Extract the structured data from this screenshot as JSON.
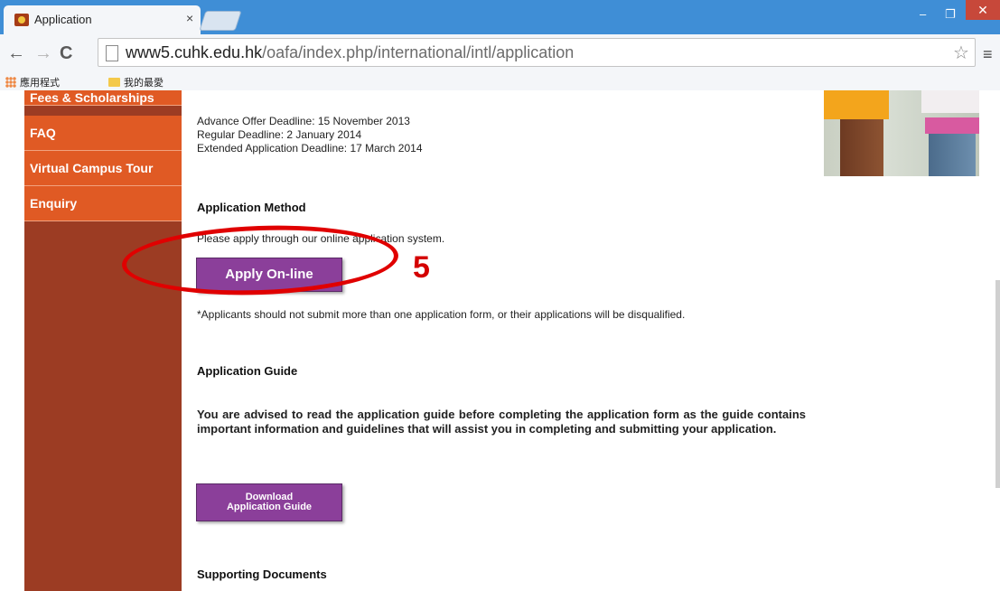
{
  "browser": {
    "tab_title": "Application",
    "tab_close": "×",
    "url_host": "www5.cuhk.edu.hk",
    "url_path": "/oafa/index.php/international/intl/application",
    "win_min": "–",
    "win_max": "❐",
    "win_close": "✕",
    "nav_back": "←",
    "nav_forward": "→",
    "nav_reload": "C",
    "star": "☆",
    "menu": "≡",
    "bookmarks": [
      {
        "label": "應用程式",
        "icon": "apps-grid-icon"
      },
      {
        "label": "我的最愛",
        "icon": "folder-icon"
      }
    ]
  },
  "sidebar": {
    "items": [
      {
        "label": "Fees & Scholarships"
      },
      {
        "label": "FAQ"
      },
      {
        "label": "Virtual Campus Tour"
      },
      {
        "label": "Enquiry"
      }
    ]
  },
  "main": {
    "deadlines": [
      "Advance Offer Deadline: 15 November 2013",
      "Regular Deadline: 2 January 2014",
      "Extended Application Deadline: 17 March 2014"
    ],
    "method_heading": "Application Method",
    "method_text": "Please apply through our online application system.",
    "apply_button": "Apply On-line",
    "apply_note": "*Applicants should not submit more than one application form, or their applications will be disqualified.",
    "guide_heading": "Application Guide",
    "guide_text": "You are advised to read the application guide before completing the application form as the guide contains important information and guidelines that will assist you in completing and submitting your application.",
    "guide_button_line1": "Download",
    "guide_button_line2": "Application Guide",
    "supporting_heading": "Supporting Documents"
  },
  "annotation": {
    "step_number": "5",
    "color": "#e00000"
  },
  "colors": {
    "tab_strip": "#3f8ed6",
    "sidebar_item": "#e05a24",
    "sidebar_bg": "#9c3c23",
    "button_purple": "#8b3f9a"
  }
}
